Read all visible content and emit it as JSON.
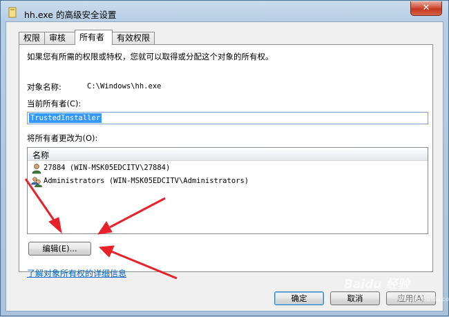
{
  "window": {
    "title": "hh.exe 的高级安全设置",
    "close_label": "✕"
  },
  "tabs": [
    {
      "label": "权限"
    },
    {
      "label": "审核"
    },
    {
      "label": "所有者"
    },
    {
      "label": "有效权限"
    }
  ],
  "owner_panel": {
    "intro": "如果您有所需的权限或特权，您就可以取得或分配这个对象的所有权。",
    "object_name_label": "对象名称:",
    "object_name_value": "C:\\Windows\\hh.exe",
    "current_owner_label": "当前所有者(C):",
    "current_owner_value": "TrustedInstaller",
    "change_owner_label": "将所有者更改为(O):",
    "list_header": "名称",
    "list_items": [
      {
        "text": "27884 (WIN-MSK05EDCITV\\27884)",
        "icon": "user-icon"
      },
      {
        "text": "Administrators (WIN-MSK05EDCITV\\Administrators)",
        "icon": "group-icon"
      }
    ],
    "edit_button": "编辑(E)...",
    "learn_more_link": "了解对象所有权的详细信息"
  },
  "footer": {
    "ok_label": "确定",
    "cancel_label": "取消",
    "apply_label": "应用(A)"
  },
  "watermark": {
    "text": "Baidu 经验",
    "sub": "jingyan.baidu.com"
  },
  "colors": {
    "selection": "#3399ff",
    "link": "#0066cc",
    "arrow": "#e8202a"
  }
}
